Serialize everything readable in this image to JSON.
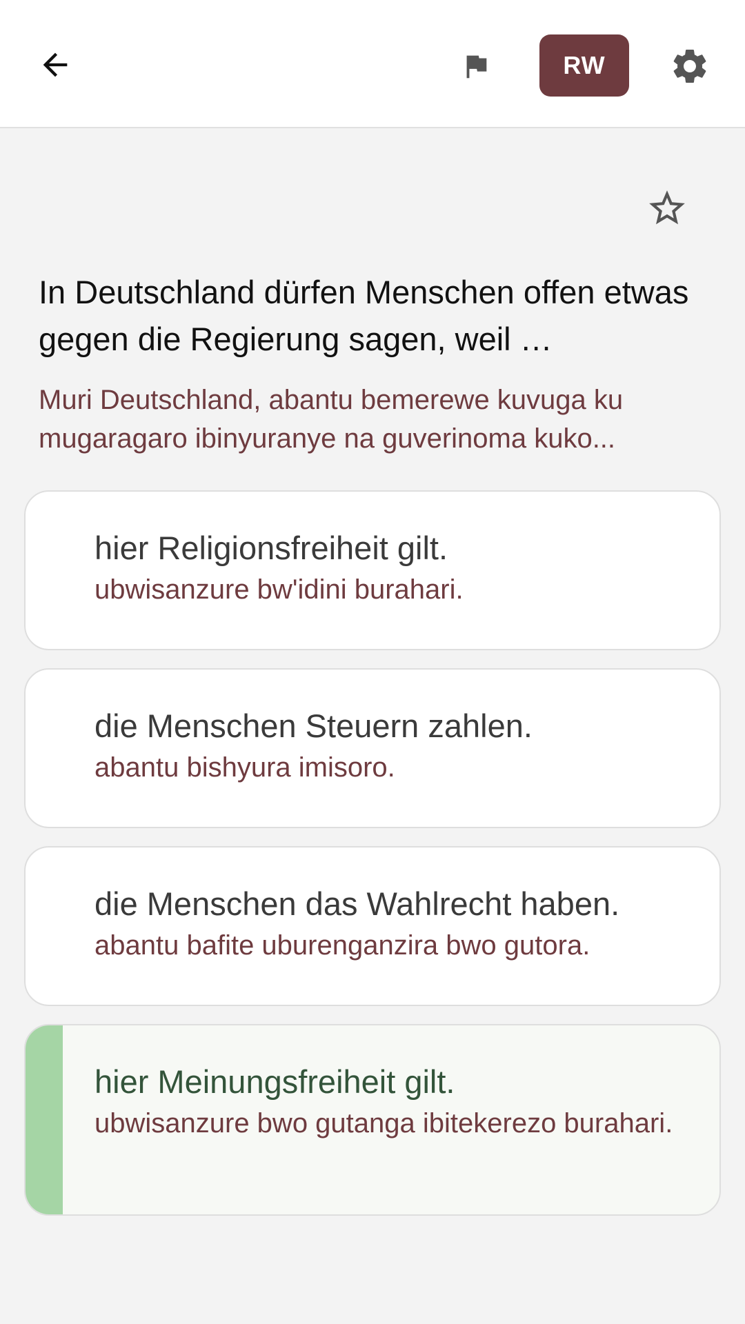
{
  "header": {
    "language_button": "RW",
    "icons": {
      "back": "arrow-back-icon",
      "flag": "flag-icon",
      "settings": "gear-icon"
    },
    "colors": {
      "accent": "#6e3b3f",
      "correct_bar": "#a5d5a5"
    }
  },
  "question": {
    "text": "In Deutschland dürfen Menschen offen etwas gegen die Regierung sagen, weil …",
    "translation": "Muri Deutschland, abantu bemerewe kuvuga ku mugaragaro ibinyuranye na guverinoma kuko...",
    "favorite_icon": "star-outline-icon"
  },
  "options": [
    {
      "text": "hier Religionsfreiheit gilt.",
      "translation": "ubwisanzure bw'idini burahari.",
      "correct": false
    },
    {
      "text": "die Menschen Steuern zahlen.",
      "translation": "abantu bishyura imisoro.",
      "correct": false
    },
    {
      "text": "die Menschen das Wahlrecht haben.",
      "translation": "abantu bafite uburenganzira bwo gutora.",
      "correct": false
    },
    {
      "text": "hier Meinungsfreiheit gilt.",
      "translation": "ubwisanzure bwo gutanga ibitekerezo burahari.",
      "correct": true
    }
  ]
}
